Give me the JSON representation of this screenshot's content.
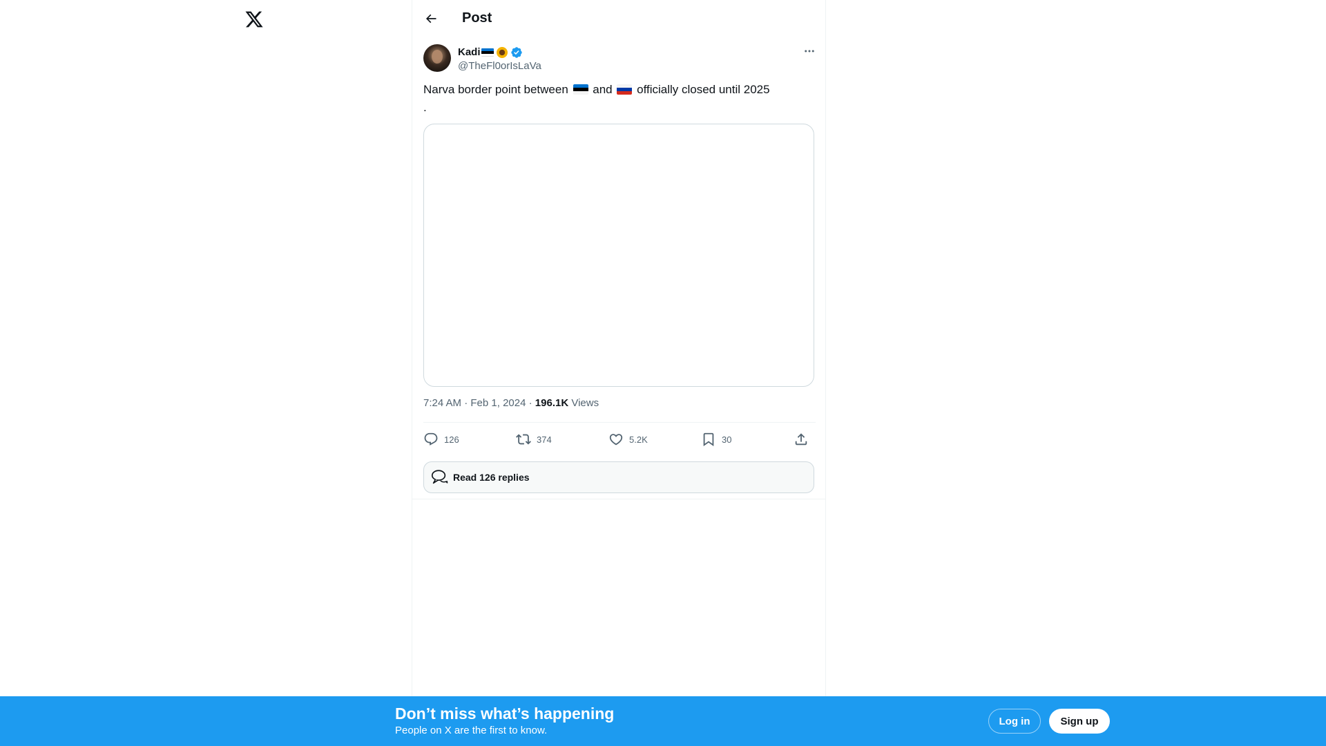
{
  "colors": {
    "accent": "#1d9bf0",
    "text_primary": "#0f1419",
    "text_secondary": "#536471",
    "border": "#cfd9de"
  },
  "nav": {
    "logo_icon": "x-logo-icon"
  },
  "header": {
    "back_icon": "arrow-left-icon",
    "title": "Post"
  },
  "tweet": {
    "author": {
      "display_name": "Kadi",
      "name_emojis": [
        "estonia-flag-icon",
        "sunflower-icon"
      ],
      "verified_icon": "verified-badge-icon",
      "handle": "@TheFl0orIsLaVa"
    },
    "more_icon": "more-dots-icon",
    "text_part1": "Narva border point between",
    "text_part2": "and",
    "text_part3": "officially closed until 2025",
    "text_dot": ".",
    "inline_flags": [
      "estonia-flag-icon",
      "russia-flag-icon"
    ],
    "time": "7:24 AM",
    "date": "Feb 1, 2024",
    "separator": "·",
    "views_count": "196.1K",
    "views_label": "Views"
  },
  "actions": {
    "reply_count": "126",
    "repost_count": "374",
    "like_count": "5.2K",
    "bookmark_count": "30"
  },
  "replies_button": {
    "label": "Read 126 replies"
  },
  "banner": {
    "title": "Don’t miss what’s happening",
    "subtitle": "People on X are the first to know.",
    "login_label": "Log in",
    "signup_label": "Sign up"
  }
}
